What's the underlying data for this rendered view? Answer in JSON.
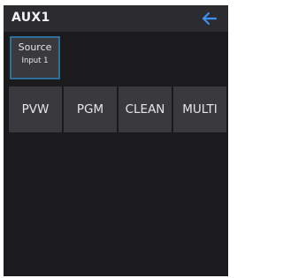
{
  "header": {
    "title": "AUX1",
    "back_icon": "arrow-left-icon",
    "accent_color": "#3d8ff0"
  },
  "source": {
    "label": "Source",
    "value": "Input 1",
    "border_color": "#2d6f9a"
  },
  "outputs": [
    {
      "label": "PVW"
    },
    {
      "label": "PGM"
    },
    {
      "label": "CLEAN"
    },
    {
      "label": "MULTI"
    }
  ]
}
